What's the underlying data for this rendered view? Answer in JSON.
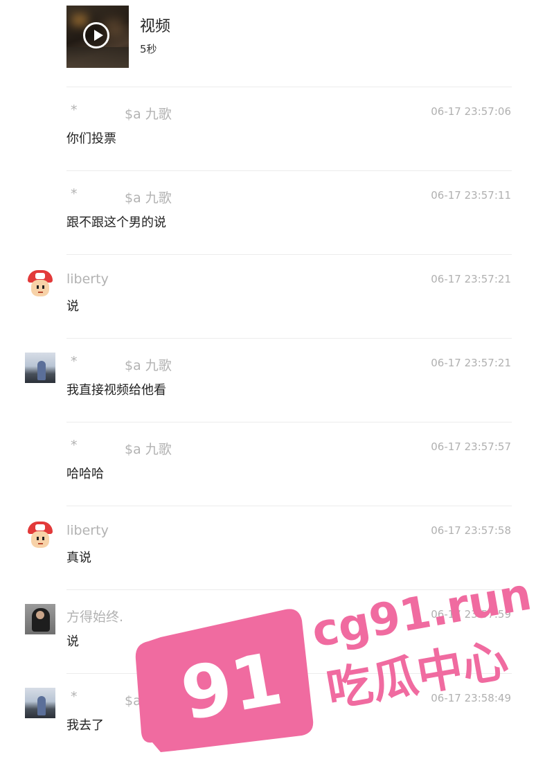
{
  "video": {
    "title": "视频",
    "duration": "5秒",
    "play_icon": "play-icon"
  },
  "messages": [
    {
      "star": "*",
      "sender": "$a 九歌",
      "time": "06-17 23:57:06",
      "text": "你们投票",
      "avatar": "none"
    },
    {
      "star": "*",
      "sender": "$a 九歌",
      "time": "06-17 23:57:11",
      "text": "跟不跟这个男的说",
      "avatar": "none"
    },
    {
      "star": "",
      "sender": "liberty",
      "time": "06-17 23:57:21",
      "text": "说",
      "avatar": "cartoon"
    },
    {
      "star": "*",
      "sender": "$a 九歌",
      "time": "06-17 23:57:21",
      "text": "我直接视频给他看",
      "avatar": "photo-figure"
    },
    {
      "star": "*",
      "sender": "$a 九歌",
      "time": "06-17 23:57:57",
      "text": "哈哈哈",
      "avatar": "none"
    },
    {
      "star": "",
      "sender": "liberty",
      "time": "06-17 23:57:58",
      "text": "真说",
      "avatar": "cartoon"
    },
    {
      "star": "",
      "sender": "方得始终.",
      "time": "06-17 23:57:59",
      "text": "说",
      "avatar": "photo-person"
    },
    {
      "star": "*",
      "sender": "$a 九歌",
      "time": "06-17 23:58:49",
      "text": "我去了",
      "avatar": "photo-figure"
    }
  ],
  "watermark": {
    "number": "91",
    "site": "cg91.run",
    "slogan": "吃瓜中心",
    "color": "#f06ba0"
  }
}
